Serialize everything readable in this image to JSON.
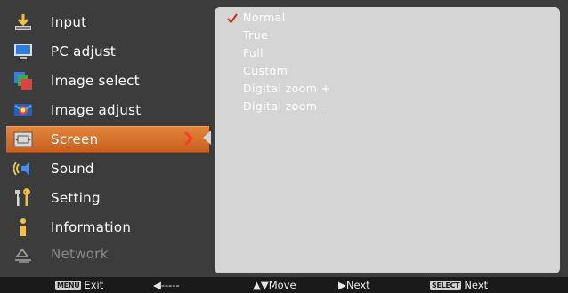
{
  "menu": {
    "items": [
      {
        "label": "Input",
        "icon": "input-icon"
      },
      {
        "label": "PC adjust",
        "icon": "monitor-icon"
      },
      {
        "label": "Image select",
        "icon": "image-select-icon"
      },
      {
        "label": "Image adjust",
        "icon": "image-adjust-icon"
      },
      {
        "label": "Screen",
        "icon": "screen-icon",
        "selected": true
      },
      {
        "label": "Sound",
        "icon": "speaker-icon"
      },
      {
        "label": "Setting",
        "icon": "setting-icon"
      },
      {
        "label": "Information",
        "icon": "information-icon"
      },
      {
        "label": "Network",
        "icon": "network-icon",
        "disabled": true
      }
    ]
  },
  "submenu": {
    "options": [
      "Normal",
      "True",
      "Full",
      "Custom",
      "Digital zoom +",
      "Digital zoom –"
    ],
    "checked": "Normal"
  },
  "footer": {
    "exit_key": "MENU",
    "exit_label": "Exit",
    "back_label": "◀-----",
    "move_label": "▲▼Move",
    "next_label": "▶Next",
    "select_key": "SELECT",
    "select_label": "Next"
  },
  "colors": {
    "background": "#3c3c3c",
    "panel": "#d5d5d5",
    "selected": "#d9732c",
    "footer": "#1a1a1a"
  }
}
